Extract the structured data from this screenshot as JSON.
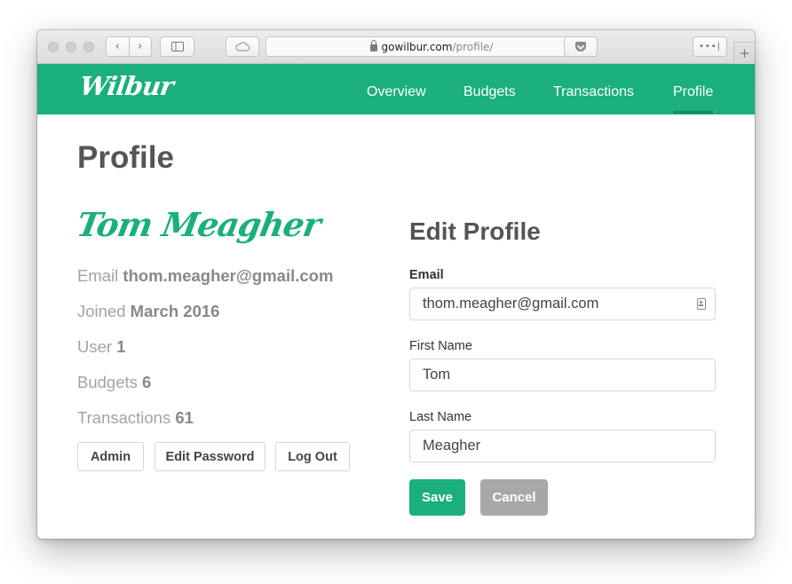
{
  "browser": {
    "url_host": "gowilbur.com",
    "url_path": "/profile/",
    "nav_back_glyph": "‹",
    "nav_forward_glyph": "›",
    "reload_glyph": "↻",
    "more_glyph": "•••|",
    "newtab_glyph": "+",
    "icons": [
      "back-icon",
      "forward-icon",
      "sidebar-icon",
      "cloud-icon",
      "lock-icon",
      "reload-icon",
      "pocket-icon",
      "more-icon",
      "new-tab-icon"
    ]
  },
  "app": {
    "logo": "Wilbur",
    "accent_color": "#1aaf7d",
    "nav": [
      {
        "label": "Overview"
      },
      {
        "label": "Budgets"
      },
      {
        "label": "Transactions"
      },
      {
        "label": "Profile",
        "active": true
      }
    ]
  },
  "profile": {
    "title": "Profile",
    "name": "Tom Meagher",
    "stats": [
      {
        "label": "Email",
        "value": "thom.meagher@gmail.com"
      },
      {
        "label": "Joined",
        "value": "March 2016"
      },
      {
        "label": "User",
        "value": "1"
      },
      {
        "label": "Budgets",
        "value": "6"
      },
      {
        "label": "Transactions",
        "value": "61"
      }
    ],
    "actions": [
      {
        "label": "Admin"
      },
      {
        "label": "Edit Password"
      },
      {
        "label": "Log Out"
      }
    ]
  },
  "edit_form": {
    "title": "Edit Profile",
    "email": {
      "label": "Email",
      "value": "thom.meagher@gmail.com"
    },
    "first_name": {
      "label": "First Name",
      "value": "Tom"
    },
    "last_name": {
      "label": "Last Name",
      "value": "Meagher"
    },
    "save_label": "Save",
    "cancel_label": "Cancel"
  }
}
